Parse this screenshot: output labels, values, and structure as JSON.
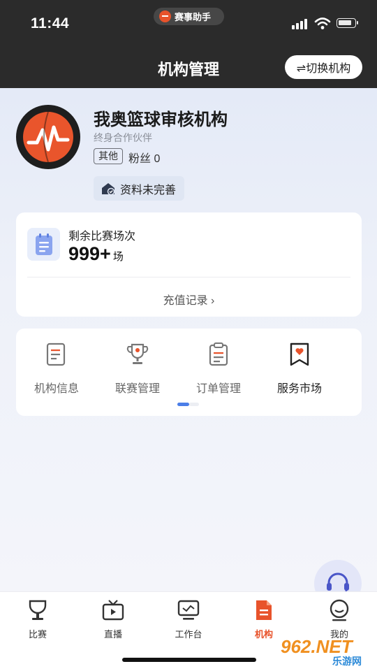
{
  "status_bar": {
    "time": "11:44",
    "app_pill": "赛事助手"
  },
  "header": {
    "title": "机构管理",
    "switch_label": "⇌切换机构"
  },
  "org": {
    "name": "我奥篮球审核机构",
    "subtitle": "终身合作伙伴",
    "tag": "其他",
    "fans_label": "粉丝",
    "fans_count": "0",
    "info_status": "资料未完善"
  },
  "balance_card": {
    "label": "剩余比赛场次",
    "value": "999+",
    "unit": "场",
    "link": "充值记录 ›"
  },
  "menu": {
    "items": [
      {
        "label": "机构信息",
        "icon": "document-icon"
      },
      {
        "label": "联赛管理",
        "icon": "trophy-icon"
      },
      {
        "label": "订单管理",
        "icon": "clipboard-icon"
      },
      {
        "label": "服务市场",
        "icon": "bookmark-heart-icon"
      }
    ],
    "page_indicator": {
      "current": 1,
      "total": 2
    }
  },
  "tabbar": {
    "items": [
      {
        "label": "比赛",
        "icon": "cup-icon"
      },
      {
        "label": "直播",
        "icon": "tv-icon"
      },
      {
        "label": "工作台",
        "icon": "monitor-icon"
      },
      {
        "label": "机构",
        "icon": "org-icon"
      },
      {
        "label": "我的",
        "icon": "smile-icon"
      }
    ],
    "active": "机构"
  },
  "watermark": {
    "main": "962.NET",
    "sub": "乐游网"
  },
  "colors": {
    "accent": "#e8532b",
    "indicator": "#4b7ee8",
    "topbar": "#2b2b2b"
  }
}
